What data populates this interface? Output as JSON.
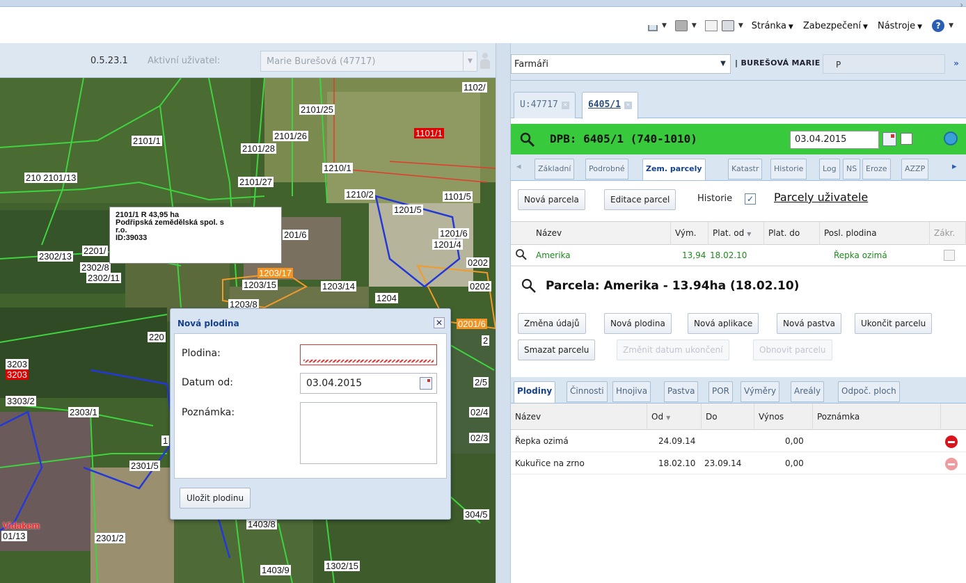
{
  "browser": {
    "menus": [
      "Stránka",
      "Zabezpečení",
      "Nástroje"
    ]
  },
  "left_header": {
    "version": "0.5.23.1",
    "active_user_label": "Aktivní uživatel:",
    "active_user_value": "Marie Burešová (47717)"
  },
  "map": {
    "parcel_labels": [
      {
        "text": "1102/",
        "style": "white"
      },
      {
        "text": "2101/25",
        "style": "white"
      },
      {
        "text": "2101/26",
        "style": "white"
      },
      {
        "text": "2101/28",
        "style": "white"
      },
      {
        "text": "1101/1",
        "style": "red"
      },
      {
        "text": "2101/1",
        "style": "white"
      },
      {
        "text": "1210/1",
        "style": "white"
      },
      {
        "text": "2101/27",
        "style": "white"
      },
      {
        "text": "210 2101/13",
        "style": "white"
      },
      {
        "text": "1210/2",
        "style": "white"
      },
      {
        "text": "1101/5",
        "style": "white"
      },
      {
        "text": "1201/5",
        "style": "white"
      },
      {
        "text": "201/6",
        "style": "white"
      },
      {
        "text": "1201/6",
        "style": "white"
      },
      {
        "text": "1201/4",
        "style": "white"
      },
      {
        "text": "0202",
        "style": "white"
      },
      {
        "text": "2302/13",
        "style": "white"
      },
      {
        "text": "2201/",
        "style": "white"
      },
      {
        "text": "2302/8",
        "style": "white"
      },
      {
        "text": "2302/11",
        "style": "white"
      },
      {
        "text": "1203/17",
        "style": "orange"
      },
      {
        "text": "1203/15",
        "style": "white"
      },
      {
        "text": "1203/14",
        "style": "white"
      },
      {
        "text": "1204",
        "style": "white"
      },
      {
        "text": "0202",
        "style": "white"
      },
      {
        "text": "1203/8",
        "style": "white"
      },
      {
        "text": "0201/6",
        "style": "orange"
      },
      {
        "text": "220",
        "style": "white"
      },
      {
        "text": "2",
        "style": "white"
      },
      {
        "text": "3203",
        "style": "white"
      },
      {
        "text": "3203",
        "style": "red"
      },
      {
        "text": "2/5",
        "style": "white"
      },
      {
        "text": "3303/2",
        "style": "white"
      },
      {
        "text": "2303/1",
        "style": "white"
      },
      {
        "text": "02/4",
        "style": "white"
      },
      {
        "text": "02/3",
        "style": "white"
      },
      {
        "text": "1",
        "style": "white"
      },
      {
        "text": "2301/5",
        "style": "white"
      },
      {
        "text": "304/5",
        "style": "white"
      },
      {
        "text": "1403/8",
        "style": "white"
      },
      {
        "text": "Vidakem",
        "style": "redtext"
      },
      {
        "text": "01/13",
        "style": "white"
      },
      {
        "text": "2301/2",
        "style": "white"
      },
      {
        "text": "1302/15",
        "style": "white"
      },
      {
        "text": "1403/9",
        "style": "white"
      }
    ],
    "tooltip": {
      "line1": "2101/1 R 43,95 ha",
      "line2": "Podřipská zemědělská spol. s",
      "line3": "r.o.",
      "line4": "ID:39033"
    }
  },
  "dialog": {
    "title": "Nová plodina",
    "plodina_label": "Plodina:",
    "plodina_value": "",
    "datum_label": "Datum od:",
    "datum_value": "03.04.2015",
    "poznamka_label": "Poznámka:",
    "poznamka_value": "",
    "save_label": "Uložit plodinu"
  },
  "right_panel": {
    "role_combo": "Farmáři",
    "user_name": "| BUREŠOVÁ MARIE",
    "p_field": "P",
    "file_tabs": [
      {
        "label": "U:47717",
        "active": false
      },
      {
        "label": "6405/1",
        "active": true
      }
    ],
    "dpb_title": "DPB: 6405/1 (740-1010)",
    "dpb_date": "03.04.2015",
    "sub_tabs": [
      "Základní",
      "Podrobné",
      "Zem. parcely",
      "Katastr",
      "Historie",
      "Log",
      "NS",
      "Eroze",
      "AZZP"
    ],
    "active_sub_tab": "Zem. parcely",
    "nova_parcela": "Nová parcela",
    "editace_parcel": "Editace parcel",
    "historie_label": "Historie",
    "parcely_link": "Parcely uživatele",
    "grid1_cols": [
      "Název",
      "Vým.",
      "Plat. od",
      "Plat. do",
      "Posl. plodina",
      "Zákr."
    ],
    "grid1_rows": [
      {
        "nazev": "Amerika",
        "vym": "13,94",
        "plat_od": "18.02.10",
        "plat_do": "",
        "posl_plodina": "Řepka ozimá"
      }
    ],
    "parcela_title": "Parcela: Amerika - 13.94ha (18.02.10)",
    "parcela_buttons": [
      "Změna údajů",
      "Nová plodina",
      "Nová aplikace",
      "Nová pastva",
      "Ukončit parcelu"
    ],
    "parcela_buttons2": [
      "Smazat parcelu",
      "Změnit datum ukončení",
      "Obnovit parcelu"
    ],
    "plodiny_tabs": [
      "Plodiny",
      "Činnosti",
      "Hnojiva",
      "Pastva",
      "POR",
      "Výměry",
      "Areály",
      "Odpoč. ploch"
    ],
    "grid2_cols": [
      "Název",
      "Od",
      "Do",
      "Výnos",
      "Poznámka"
    ],
    "grid2_rows": [
      {
        "nazev": "Řepka ozimá",
        "od": "24.09.14",
        "do": "",
        "vynos": "0,00",
        "poznamka": ""
      },
      {
        "nazev": "Kukuřice na zrno",
        "od": "18.02.10",
        "do": "23.09.14",
        "vynos": "0,00",
        "poznamka": ""
      }
    ]
  }
}
